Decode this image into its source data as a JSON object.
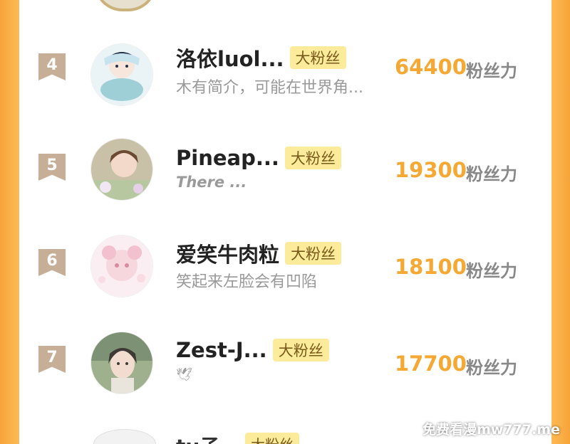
{
  "list_item_label": "粉丝力",
  "badge_label": "大粉丝",
  "rows": [
    {
      "rank": "4",
      "name": "洛依luol...",
      "bio": "木有简介，可能在世界角...",
      "count": "64400"
    },
    {
      "rank": "5",
      "name": "Pineap...",
      "bio": "There ...",
      "count": "19300"
    },
    {
      "rank": "6",
      "name": "爱笑牛肉粒",
      "bio": "笑起来左脸会有凹陷",
      "count": "18100"
    },
    {
      "rank": "7",
      "name": "Zest-J...",
      "bio": "🕊",
      "count": "17700"
    }
  ],
  "partial_row": {
    "name": "tu子",
    "badge": "大粉丝"
  },
  "watermark": "免费看漫mw777.me",
  "colors": {
    "accent": "#f5a833",
    "rank_bg": "#c6ae97",
    "badge_bg": "#fbeb9b",
    "border_orange": "#fdbb55"
  }
}
